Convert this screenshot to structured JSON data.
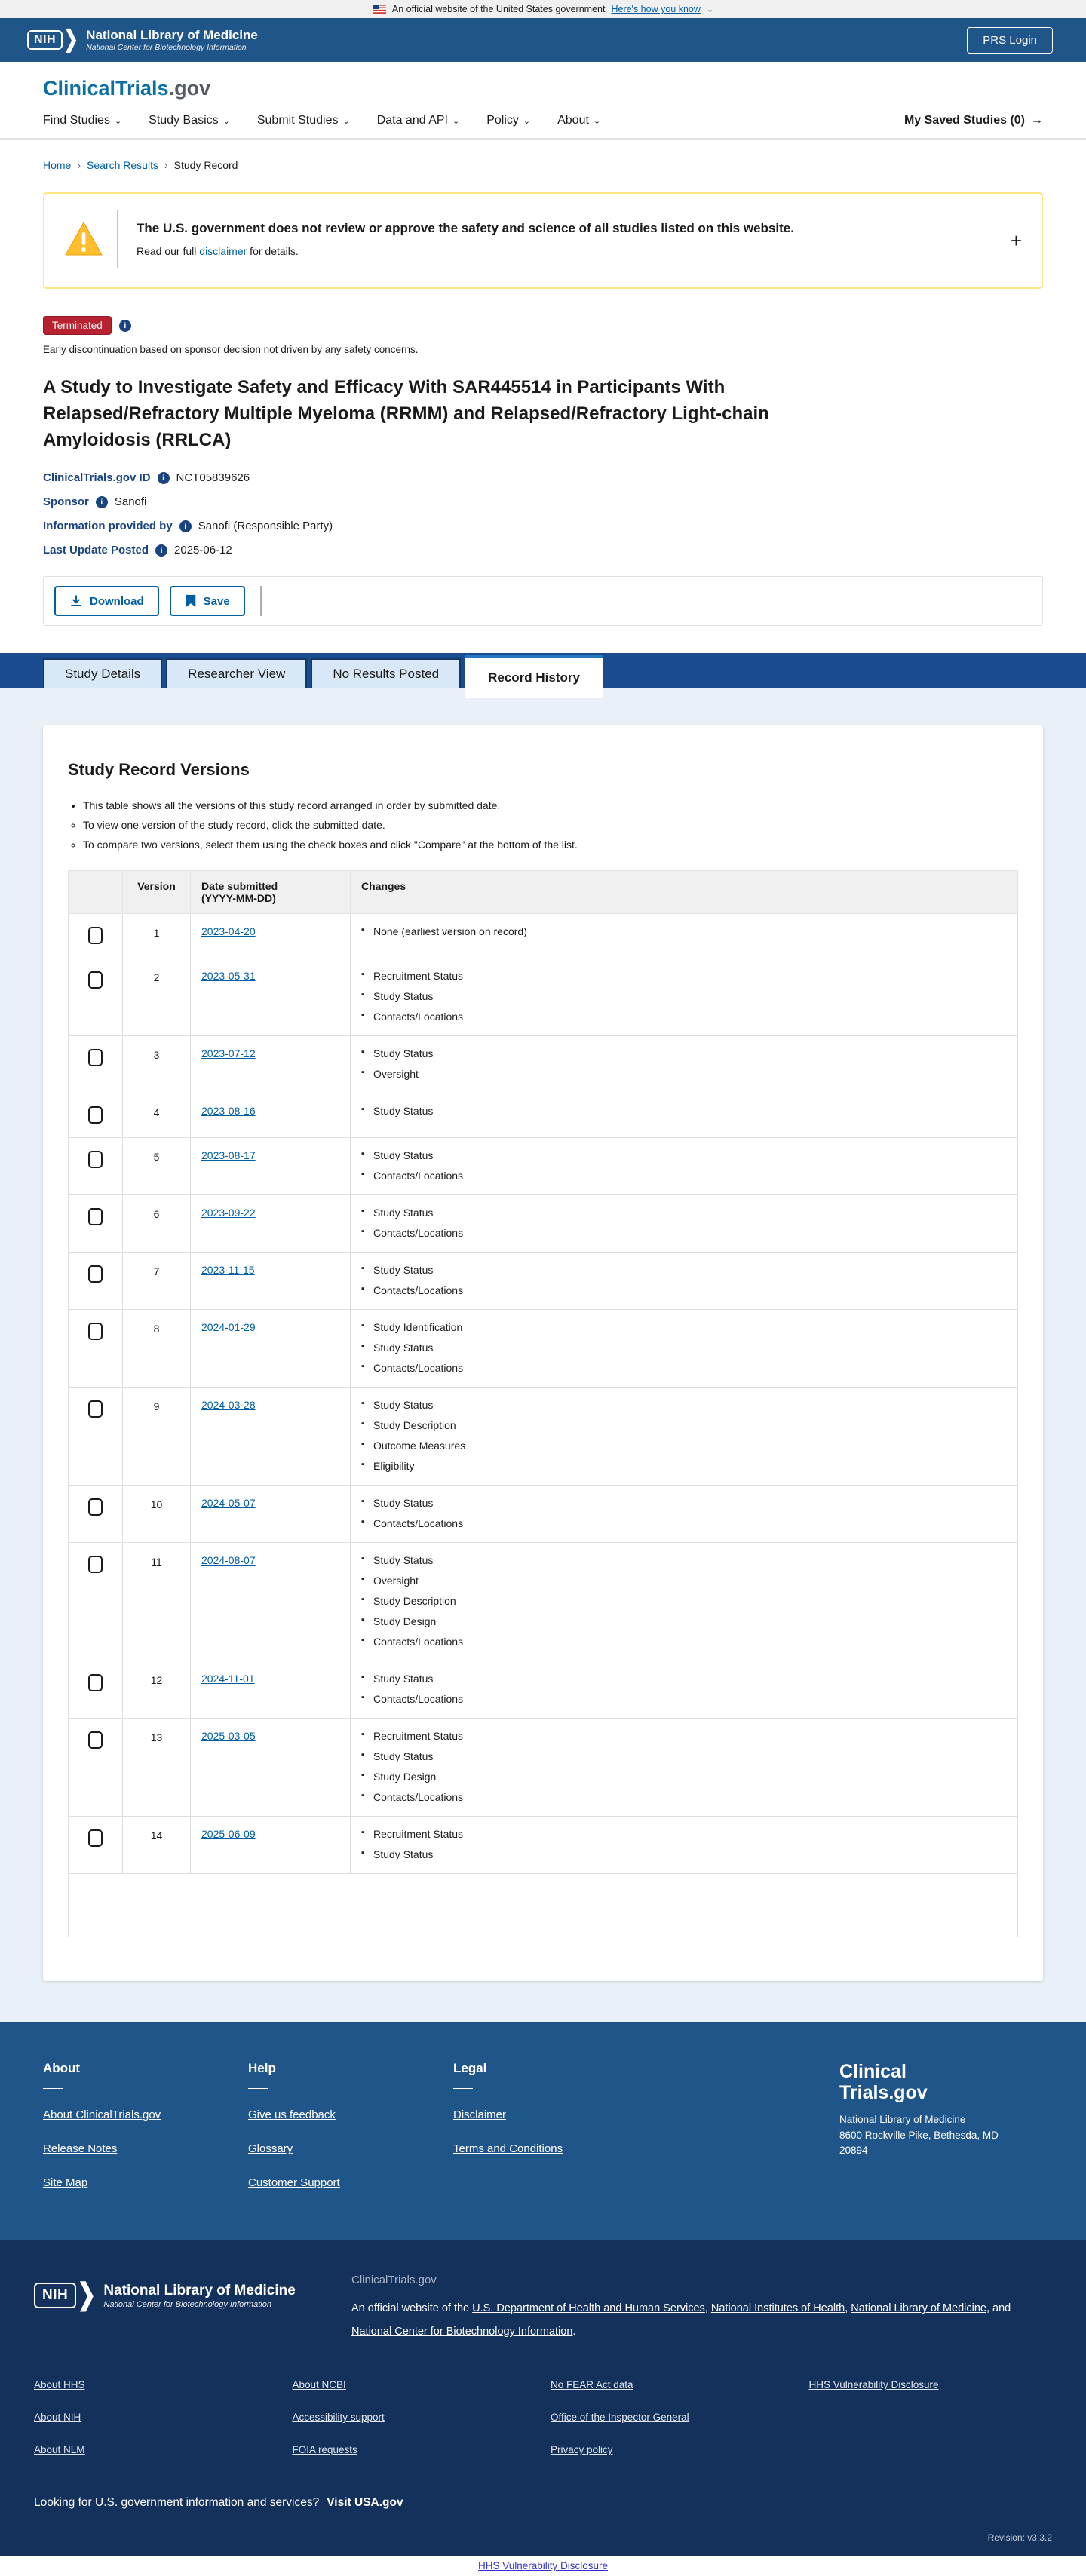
{
  "icons": {
    "chevron_down": "⌄",
    "arrow_right": "→",
    "info": "i",
    "breadcrumb_sep": "›"
  },
  "banner": {
    "text": "An official website of the United States government",
    "link": "Here's how you know"
  },
  "header": {
    "nih_acronym": "NIH",
    "org": "National Library of Medicine",
    "org_sub": "National Center for Biotechnology Information",
    "login_label": "PRS Login"
  },
  "site": {
    "logo_primary": "ClinicalTrials",
    "logo_suffix": ".gov",
    "nav": [
      "Find Studies",
      "Study Basics",
      "Submit Studies",
      "Data and API",
      "Policy",
      "About"
    ],
    "saved_label": "My Saved Studies (0)"
  },
  "breadcrumb": {
    "links": [
      "Home",
      "Search Results"
    ],
    "current": "Study Record"
  },
  "alert": {
    "title": "The U.S. government does not review or approve the safety and science of all studies listed on this website.",
    "body_prefix": "Read our full ",
    "body_link": "disclaimer",
    "body_suffix": " for details.",
    "expand": "+"
  },
  "study": {
    "status": "Terminated",
    "status_note": "Early discontinuation based on sponsor decision not driven by any safety concerns.",
    "title": "A Study to Investigate Safety and Efficacy With SAR445514 in Participants With Relapsed/Refractory Multiple Myeloma (RRMM) and Relapsed/Refractory Light-chain Amyloidosis (RRLCA)",
    "fields": [
      {
        "label": "ClinicalTrials.gov ID",
        "value": "NCT05839626"
      },
      {
        "label": "Sponsor",
        "value": "Sanofi"
      },
      {
        "label": "Information provided by",
        "value": "Sanofi (Responsible Party)"
      },
      {
        "label": "Last Update Posted",
        "value": "2025-06-12"
      }
    ]
  },
  "toolbar": {
    "download_label": "Download",
    "save_label": "Save"
  },
  "tabs": [
    {
      "label": "Study Details",
      "active": false
    },
    {
      "label": "Researcher View",
      "active": false
    },
    {
      "label": "No Results Posted",
      "active": false
    },
    {
      "label": "Record History",
      "active": true
    }
  ],
  "versions": {
    "heading": "Study Record Versions",
    "intro": "This table shows all the versions of this study record arranged in order by submitted date.",
    "sub_bullets": [
      "To view one version of the study record, click the submitted date.",
      "To compare two versions, select them using the check boxes and click \"Compare\" at the bottom of the list."
    ],
    "columns": {
      "version": "Version",
      "date_line1": "Date submitted",
      "date_line2": "(YYYY-MM-DD)",
      "changes": "Changes"
    },
    "rows": [
      {
        "version": "1",
        "date": "2023-04-20",
        "changes": [
          "None (earliest version on record)"
        ]
      },
      {
        "version": "2",
        "date": "2023-05-31",
        "changes": [
          "Recruitment Status",
          "Study Status",
          "Contacts/Locations"
        ]
      },
      {
        "version": "3",
        "date": "2023-07-12",
        "changes": [
          "Study Status",
          "Oversight"
        ]
      },
      {
        "version": "4",
        "date": "2023-08-16",
        "changes": [
          "Study Status"
        ]
      },
      {
        "version": "5",
        "date": "2023-08-17",
        "changes": [
          "Study Status",
          "Contacts/Locations"
        ]
      },
      {
        "version": "6",
        "date": "2023-09-22",
        "changes": [
          "Study Status",
          "Contacts/Locations"
        ]
      },
      {
        "version": "7",
        "date": "2023-11-15",
        "changes": [
          "Study Status",
          "Contacts/Locations"
        ]
      },
      {
        "version": "8",
        "date": "2024-01-29",
        "changes": [
          "Study Identification",
          "Study Status",
          "Contacts/Locations"
        ]
      },
      {
        "version": "9",
        "date": "2024-03-28",
        "changes": [
          "Study Status",
          "Study Description",
          "Outcome Measures",
          "Eligibility"
        ]
      },
      {
        "version": "10",
        "date": "2024-05-07",
        "changes": [
          "Study Status",
          "Contacts/Locations"
        ]
      },
      {
        "version": "11",
        "date": "2024-08-07",
        "changes": [
          "Study Status",
          "Oversight",
          "Study Description",
          "Study Design",
          "Contacts/Locations"
        ]
      },
      {
        "version": "12",
        "date": "2024-11-01",
        "changes": [
          "Study Status",
          "Contacts/Locations"
        ]
      },
      {
        "version": "13",
        "date": "2025-03-05",
        "changes": [
          "Recruitment Status",
          "Study Status",
          "Study Design",
          "Contacts/Locations"
        ]
      },
      {
        "version": "14",
        "date": "2025-06-09",
        "changes": [
          "Recruitment Status",
          "Study Status"
        ]
      }
    ]
  },
  "footer": {
    "columns": [
      {
        "heading": "About",
        "links": [
          "About ClinicalTrials.gov",
          "Release Notes",
          "Site Map"
        ]
      },
      {
        "heading": "Help",
        "links": [
          "Give us feedback",
          "Glossary",
          "Customer Support"
        ]
      },
      {
        "heading": "Legal",
        "links": [
          "Disclaimer",
          "Terms and Conditions"
        ]
      }
    ],
    "brand_line1": "Clinical",
    "brand_line2": "Trials.gov",
    "address_lines": [
      "National Library of Medicine",
      "8600 Rockville Pike, Bethesda, MD",
      "20894"
    ]
  },
  "subfooter": {
    "nih_acronym": "NIH",
    "org": "National Library of Medicine",
    "org_sub": "National Center for Biotechnology Information",
    "site_name": "ClinicalTrials.gov",
    "official_parts": [
      {
        "text": "An official website of the "
      },
      {
        "link": "U.S. Department of Health and Human Services"
      },
      {
        "text": ", "
      },
      {
        "link": "National Institutes of Health"
      },
      {
        "text": ", "
      },
      {
        "link": "National Library of Medicine"
      },
      {
        "text": ", and "
      },
      {
        "link": "National Center for Biotechnology Information"
      },
      {
        "text": "."
      }
    ],
    "link_columns": [
      [
        "About HHS",
        "About NIH",
        "About NLM"
      ],
      [
        "About NCBI",
        "Accessibility support",
        "FOIA requests"
      ],
      [
        "No FEAR Act data",
        "Office of the Inspector General",
        "Privacy policy"
      ],
      [
        "HHS Vulnerability Disclosure"
      ]
    ],
    "usa_text": "Looking for U.S. government information and services?",
    "usa_link": "Visit USA.gov",
    "revision": "Revision: v3.3.2"
  },
  "bottom": {
    "link": "HHS Vulnerability Disclosure"
  }
}
